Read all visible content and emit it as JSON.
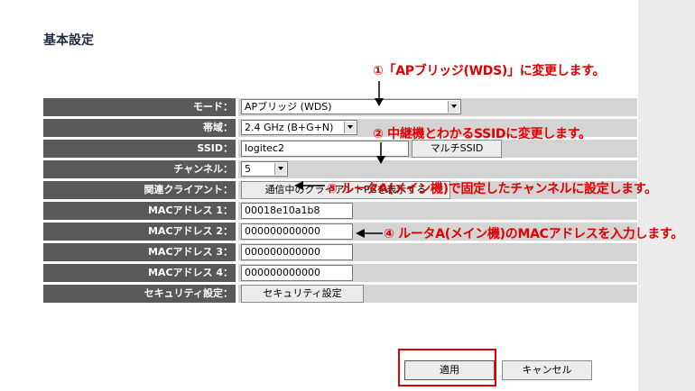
{
  "page": {
    "title": "基本設定"
  },
  "form": {
    "mode": {
      "label": "モード：",
      "value": "APブリッジ (WDS)"
    },
    "band": {
      "label": "帯域：",
      "value": "2.4 GHz (B+G+N)"
    },
    "ssid": {
      "label": "SSID：",
      "value": "logitec2",
      "multi_button": "マルチSSID"
    },
    "channel": {
      "label": "チャンネル：",
      "value": "5"
    },
    "clients": {
      "label": "関連クライアント：",
      "button": "通信中のクライアントPCを表示する"
    },
    "mac1": {
      "label": "MACアドレス 1：",
      "value": "00018e10a1b8"
    },
    "mac2": {
      "label": "MACアドレス 2：",
      "value": "000000000000"
    },
    "mac3": {
      "label": "MACアドレス 3：",
      "value": "000000000000"
    },
    "mac4": {
      "label": "MACアドレス 4：",
      "value": "000000000000"
    },
    "security": {
      "label": "セキュリティ設定：",
      "button": "セキュリティ設定"
    }
  },
  "actions": {
    "apply": "適用",
    "cancel": "キャンセル"
  },
  "annotations": {
    "note1": "①「APブリッジ(WDS)」に変更します。",
    "note2": "② 中継機とわかるSSIDに変更します。",
    "note3": "③ ルータA(メイン機)で固定したチャンネルに設定します。",
    "note4": "④ ルータA(メイン機)のMACアドレスを入力します。"
  },
  "colors": {
    "annotation": "#e00000",
    "label_bg": "#595959",
    "value_bg": "#d4d4d4"
  }
}
